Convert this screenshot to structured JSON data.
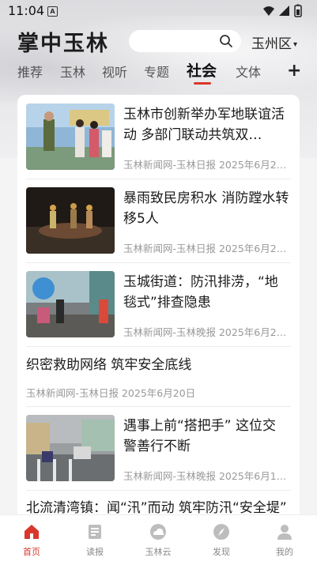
{
  "status_bar": {
    "time": "11:04",
    "sim_label": "A"
  },
  "header": {
    "logo": "掌中玉林",
    "search_placeholder": "",
    "region": "玉州区",
    "region_caret": "▾"
  },
  "tabs": [
    {
      "label": "推荐"
    },
    {
      "label": "玉林"
    },
    {
      "label": "视听"
    },
    {
      "label": "专题"
    },
    {
      "label": "社会",
      "active": true
    },
    {
      "label": "文体"
    }
  ],
  "tab_plus": "+",
  "news": [
    {
      "title": "玉林市创新举办军地联谊活动 多部门联动共筑双…",
      "meta": "玉林新闻网-玉林日报  2025年6月2…",
      "has_image": true,
      "image": "military-event-photo"
    },
    {
      "title": "暴雨致民房积水 消防蹚水转移5人",
      "meta": "玉林新闻网-玉林日报  2025年6月2…",
      "has_image": true,
      "image": "night-rescue-boat-photo"
    },
    {
      "title": "玉城街道：防汛排涝，“地毯式”排查隐患",
      "meta": "玉林新闻网-玉林晚报  2025年6月2…",
      "has_image": true,
      "image": "street-flood-drain-photo"
    },
    {
      "title": "织密救助网络 筑牢安全底线",
      "meta": "玉林新闻网-玉林日报  2025年6月20日",
      "has_image": false
    },
    {
      "title": "遇事上前“搭把手” 这位交警善行不断",
      "meta": "玉林新闻网-玉林晚报  2025年6月1…",
      "has_image": true,
      "image": "traffic-police-rain-photo"
    },
    {
      "title": "北流清湾镇：闻“汛”而动 筑牢防汛“安全堤”",
      "meta": "",
      "has_image": false
    }
  ],
  "bottom_nav": [
    {
      "label": "首页",
      "icon": "home-icon",
      "active": true
    },
    {
      "label": "读报",
      "icon": "newspaper-icon"
    },
    {
      "label": "玉林云",
      "icon": "cloud-icon"
    },
    {
      "label": "发现",
      "icon": "discover-icon"
    },
    {
      "label": "我的",
      "icon": "profile-icon"
    }
  ],
  "colors": {
    "accent": "#d9372c",
    "text": "#1a1a1a",
    "meta": "#999999"
  }
}
